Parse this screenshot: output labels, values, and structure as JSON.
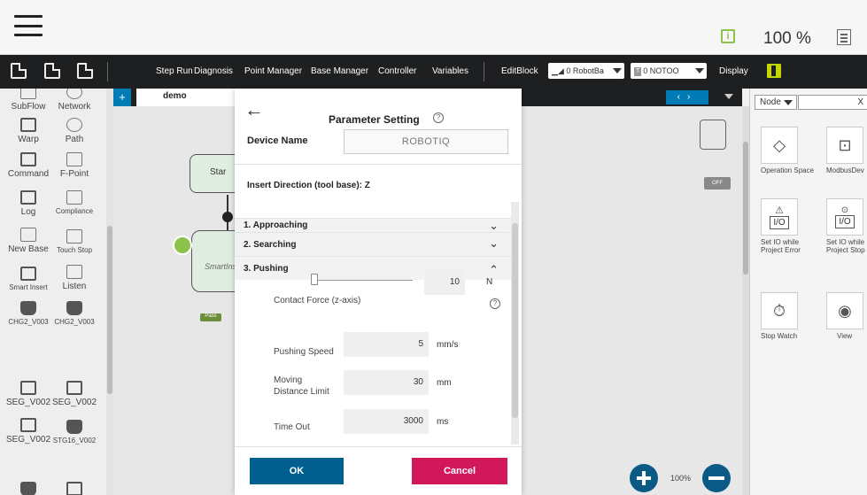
{
  "topbar": {
    "zoom_level": "100 %"
  },
  "toolbar": {
    "buttons": [
      "Step Run",
      "Diagnosis",
      "Point Manager",
      "Base Manager",
      "Controller",
      "Variables",
      "EditBlock",
      "Display"
    ],
    "robot_base_select": "0 RobotBa",
    "tool_select_tag": "T",
    "tool_select": "0 NOTOO"
  },
  "palette": {
    "items": [
      {
        "label": "SubFlow"
      },
      {
        "label": "Network"
      },
      {
        "label": "Warp"
      },
      {
        "label": "Path"
      },
      {
        "label": "Command"
      },
      {
        "label": "F-Point"
      },
      {
        "label": "Log"
      },
      {
        "label": "Compliance"
      },
      {
        "label": "New Base"
      },
      {
        "label": "Touch Stop"
      },
      {
        "label": "Smart Insert"
      },
      {
        "label": "Listen"
      },
      {
        "label": "CHG2_V003"
      },
      {
        "label": "CHG2_V003"
      },
      {
        "label": "SEG_V002"
      },
      {
        "label": "SEG_V002"
      },
      {
        "label": "SEG_V002"
      },
      {
        "label": "STG16_V002"
      }
    ]
  },
  "flow": {
    "tab_name": "demo",
    "start_label": "Star",
    "node_label": "SmartIns",
    "pass_label": "Pass",
    "off_label": "OFF",
    "zoom_percent": "100%"
  },
  "nodepanel": {
    "filter": "Node",
    "search_clear": "X",
    "items": [
      {
        "label": "Operation Space",
        "icon": "cube-icon"
      },
      {
        "label": "ModbusDev",
        "icon": "modbus-icon"
      },
      {
        "label": "Set IO while Project Error",
        "icon": "io-warning-icon",
        "io": "I/O"
      },
      {
        "label": "Set IO while Project Stop",
        "icon": "io-stop-icon",
        "io": "I/O"
      },
      {
        "label": "Stop Watch",
        "icon": "stopwatch-icon"
      },
      {
        "label": "View",
        "icon": "eye-icon"
      }
    ]
  },
  "dialog": {
    "title": "Parameter Setting",
    "device_name_label": "Device Name",
    "device_name_value": "ROBOTIQ",
    "insert_direction": "Insert Direction (tool base): Z",
    "sections": [
      {
        "label": "1. Approaching"
      },
      {
        "label": "2. Searching"
      },
      {
        "label": "3. Pushing"
      }
    ],
    "contact_force_label": "Contact Force (z-axis)",
    "contact_force_value": "10",
    "contact_force_unit": "N",
    "pushing_speed_label": "Pushing Speed",
    "pushing_speed_value": "5",
    "pushing_speed_unit": "mm/s",
    "moving_distance_label": "Moving Distance Limit",
    "moving_distance_value": "30",
    "moving_distance_unit": "mm",
    "time_out_label": "Time Out",
    "time_out_value": "3000",
    "time_out_unit": "ms",
    "ok_label": "OK",
    "cancel_label": "Cancel"
  }
}
